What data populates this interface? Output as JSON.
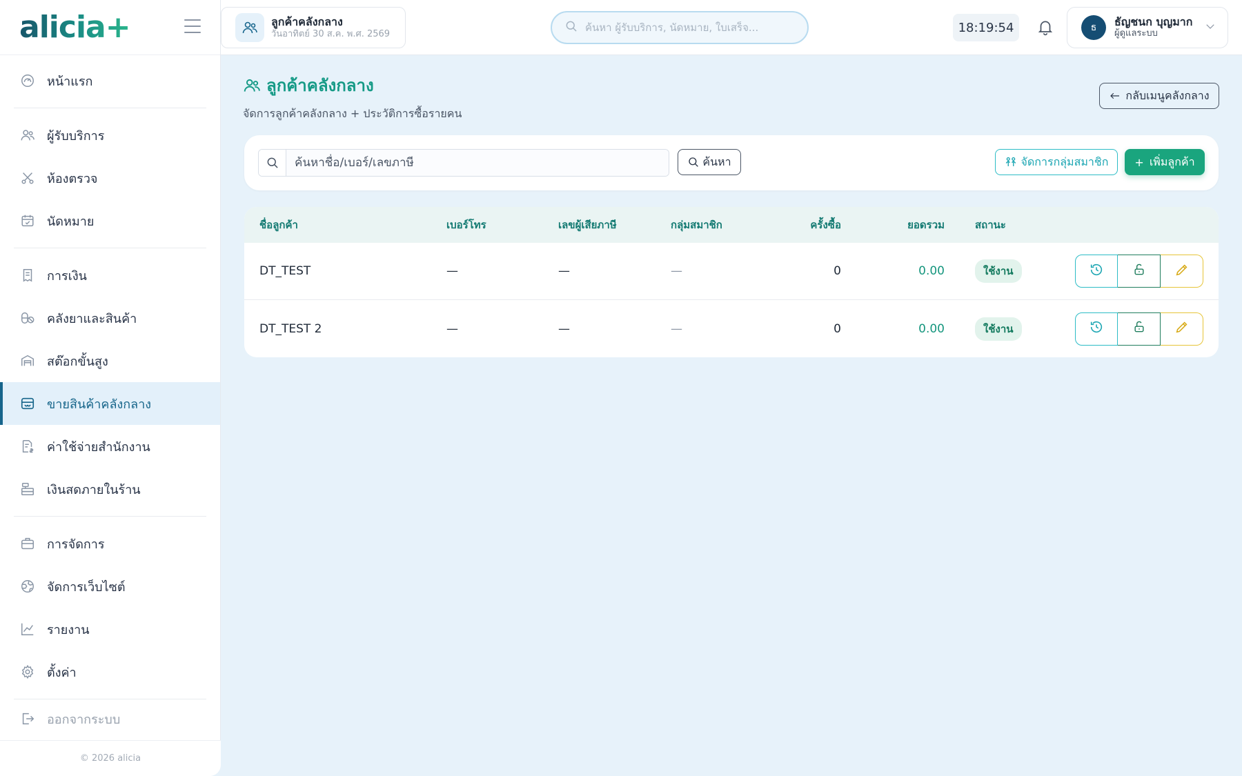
{
  "app": {
    "brand": "alicia+",
    "copyright": "© 2026 alicia"
  },
  "sidebar": {
    "items": [
      {
        "label": "หน้าแรก",
        "icon": "gauge-icon"
      },
      {
        "label": "ผู้รับบริการ",
        "icon": "users-icon"
      },
      {
        "label": "ห้องตรวจ",
        "icon": "scissors-icon"
      },
      {
        "label": "นัดหมาย",
        "icon": "calendar-check-icon"
      },
      {
        "label": "การเงิน",
        "icon": "receipt-icon"
      },
      {
        "label": "คลังยาและสินค้า",
        "icon": "pills-icon"
      },
      {
        "label": "สต๊อกขั้นสูง",
        "icon": "warehouse-icon"
      },
      {
        "label": "ขายสินค้าคลังกลาง",
        "icon": "store-icon",
        "active": true
      },
      {
        "label": "ค่าใช้จ่ายสำนักงาน",
        "icon": "expense-icon"
      },
      {
        "label": "เงินสดภายในร้าน",
        "icon": "cash-register-icon"
      },
      {
        "label": "การจัดการ",
        "icon": "briefcase-icon"
      },
      {
        "label": "จัดการเว็บไซต์",
        "icon": "globe-icon"
      },
      {
        "label": "รายงาน",
        "icon": "chart-line-icon"
      },
      {
        "label": "ตั้งค่า",
        "icon": "gear-icon"
      },
      {
        "label": "ออกจากระบบ",
        "icon": "logout-icon"
      }
    ]
  },
  "topbar": {
    "page_title": "ลูกค้าคลังกลาง",
    "page_date": "วันอาทิตย์ 30 ส.ค. พ.ศ. 2569",
    "search_placeholder": "ค้นหา ผู้รับบริการ, นัดหมาย, ใบเสร็จ...",
    "clock": "18:19:54",
    "user_initial": "ธ",
    "user_name": "ธัญชนก บุญมาก",
    "user_role": "ผู้ดูแลระบบ"
  },
  "main": {
    "title": "ลูกค้าคลังกลาง",
    "subtitle": "จัดการลูกค้าคลังกลาง + ประวัติการซื้อรายคน",
    "back_label": "กลับเมนูคลังกลาง",
    "search_placeholder": "ค้นหาชื่อ/เบอร์/เลขภาษี",
    "search_button": "ค้นหา",
    "group_button": "จัดการกลุ่มสมาชิก",
    "add_button": "เพิ่มลูกค้า"
  },
  "table": {
    "columns": [
      "ชื่อลูกค้า",
      "เบอร์โทร",
      "เลขผู้เสียภาษี",
      "กลุ่มสมาชิก",
      "ครั้งซื้อ",
      "ยอดรวม",
      "สถานะ"
    ],
    "rows": [
      {
        "name": "DT_TEST",
        "phone": "—",
        "tax": "—",
        "group": "—",
        "count": "0",
        "total": "0.00",
        "status": "ใช้งาน"
      },
      {
        "name": "DT_TEST 2",
        "phone": "—",
        "tax": "—",
        "group": "—",
        "count": "0",
        "total": "0.00",
        "status": "ใช้งาน"
      }
    ]
  },
  "colors": {
    "primary": "#17658c",
    "accent_green": "#1aa57e",
    "teal": "#2cbcc6",
    "yellow": "#e6c437",
    "background": "#e7f2fa"
  }
}
